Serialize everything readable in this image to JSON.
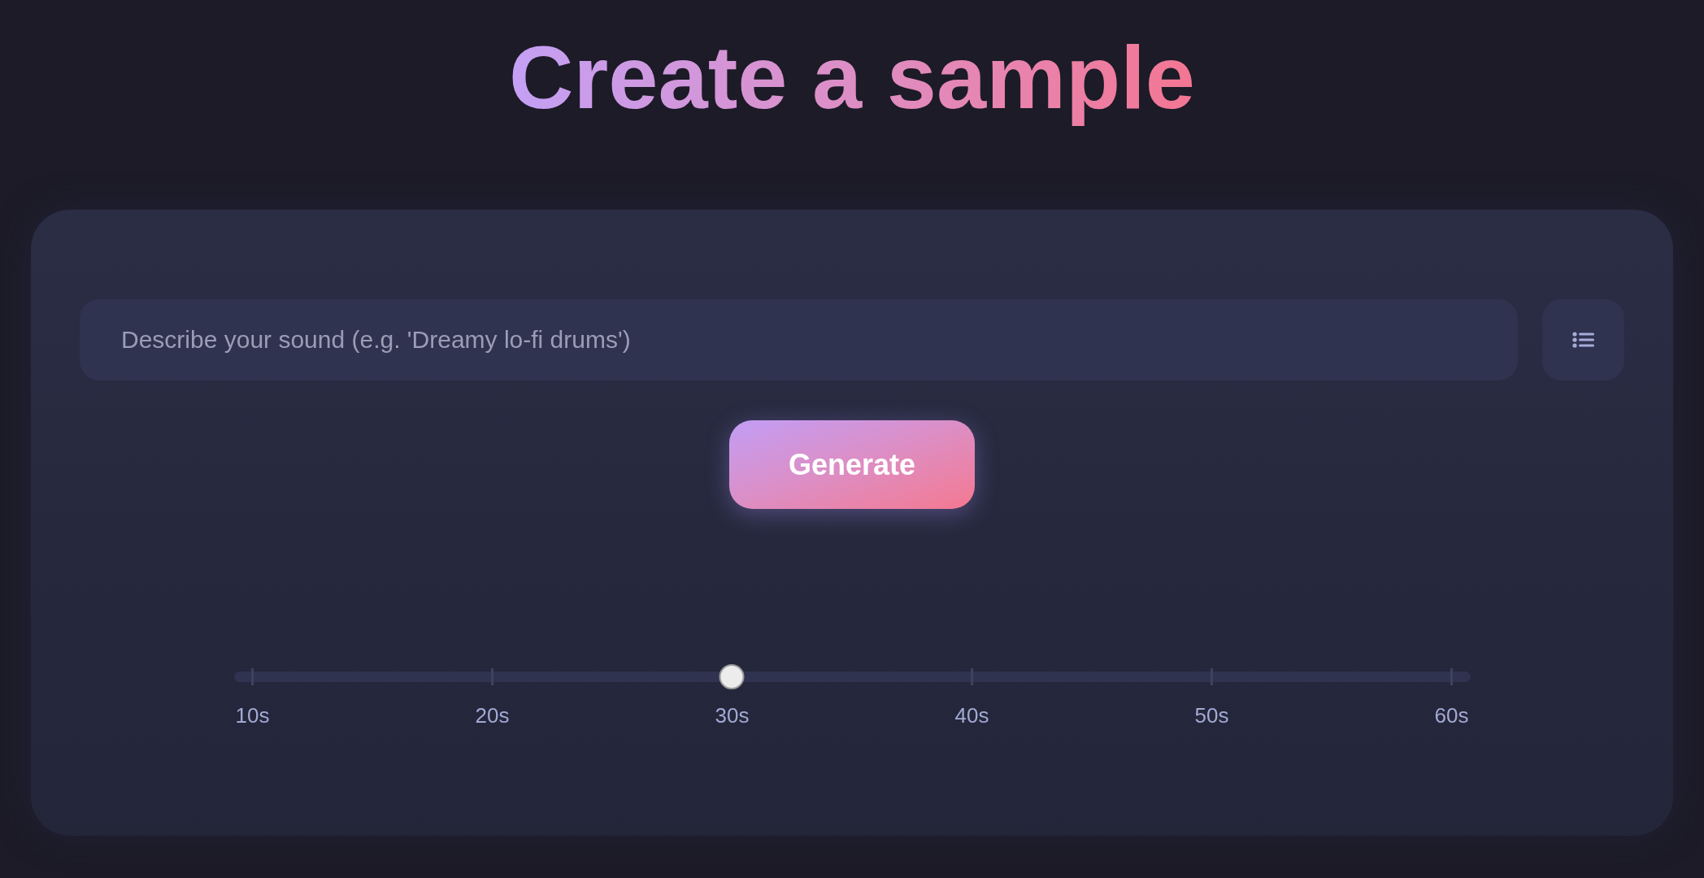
{
  "title": "Create a sample",
  "prompt_field": {
    "placeholder": "Describe your sound (e.g. 'Dreamy lo-fi drums')"
  },
  "generate_button": {
    "label": "Generate"
  },
  "duration_slider": {
    "level": 0.4,
    "labels": [
      "10s",
      "20s",
      "30s",
      "40s",
      "50s",
      "60s"
    ]
  }
}
